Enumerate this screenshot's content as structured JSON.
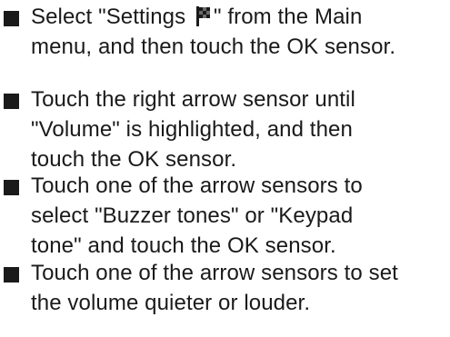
{
  "steps": [
    {
      "lines": [
        {
          "before_icon": "Select \"Settings ",
          "icon": "flag-icon",
          "after_icon": "\" from the Main"
        },
        "menu, and then touch the OK sensor."
      ]
    },
    {
      "lines": [
        "Touch the right arrow sensor until",
        "\"Volume\" is highlighted, and then",
        "touch the OK sensor."
      ]
    },
    {
      "lines": [
        "Touch one of the arrow sensors to",
        "select \"Buzzer tones\" or \"Keypad",
        "tone\" and touch the OK sensor."
      ]
    },
    {
      "lines": [
        "Touch one of the arrow sensors to set",
        "the volume quieter or louder."
      ]
    }
  ]
}
